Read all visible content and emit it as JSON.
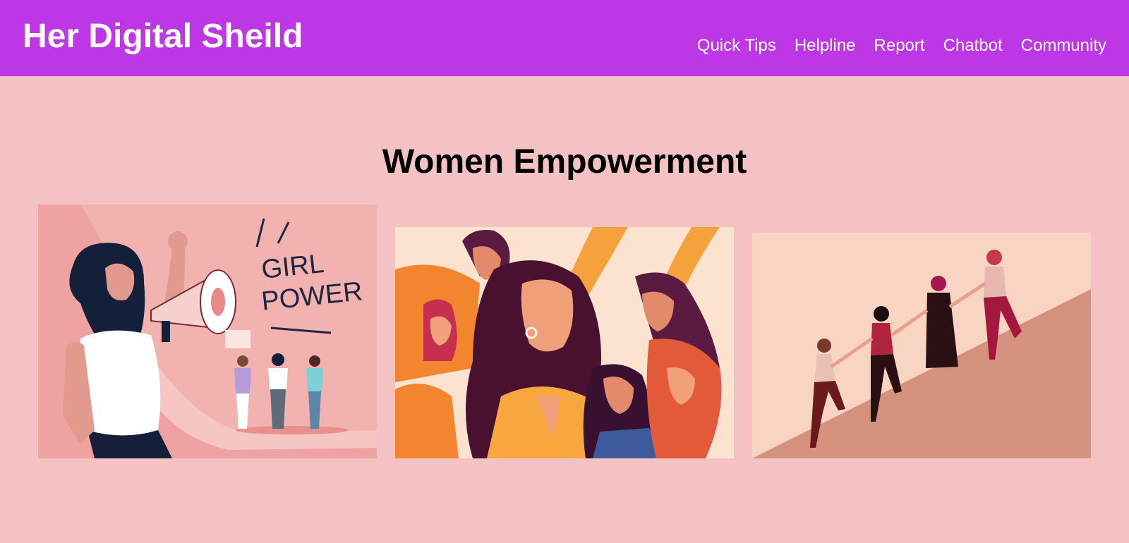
{
  "header": {
    "brand": "Her Digital Sheild",
    "bg_color": "#bd37e6",
    "nav": [
      "Quick Tips",
      "Helpline",
      "Report",
      "Chatbot",
      "Community"
    ]
  },
  "main": {
    "title": "Women Empowerment",
    "bg_color": "#f4c2c2",
    "images": [
      {
        "name": "girl-power-megaphone-illustration",
        "lettering": [
          "GIRL",
          "POWER"
        ]
      },
      {
        "name": "women-group-portrait-illustration"
      },
      {
        "name": "women-climbing-stairs-illustration"
      }
    ]
  }
}
